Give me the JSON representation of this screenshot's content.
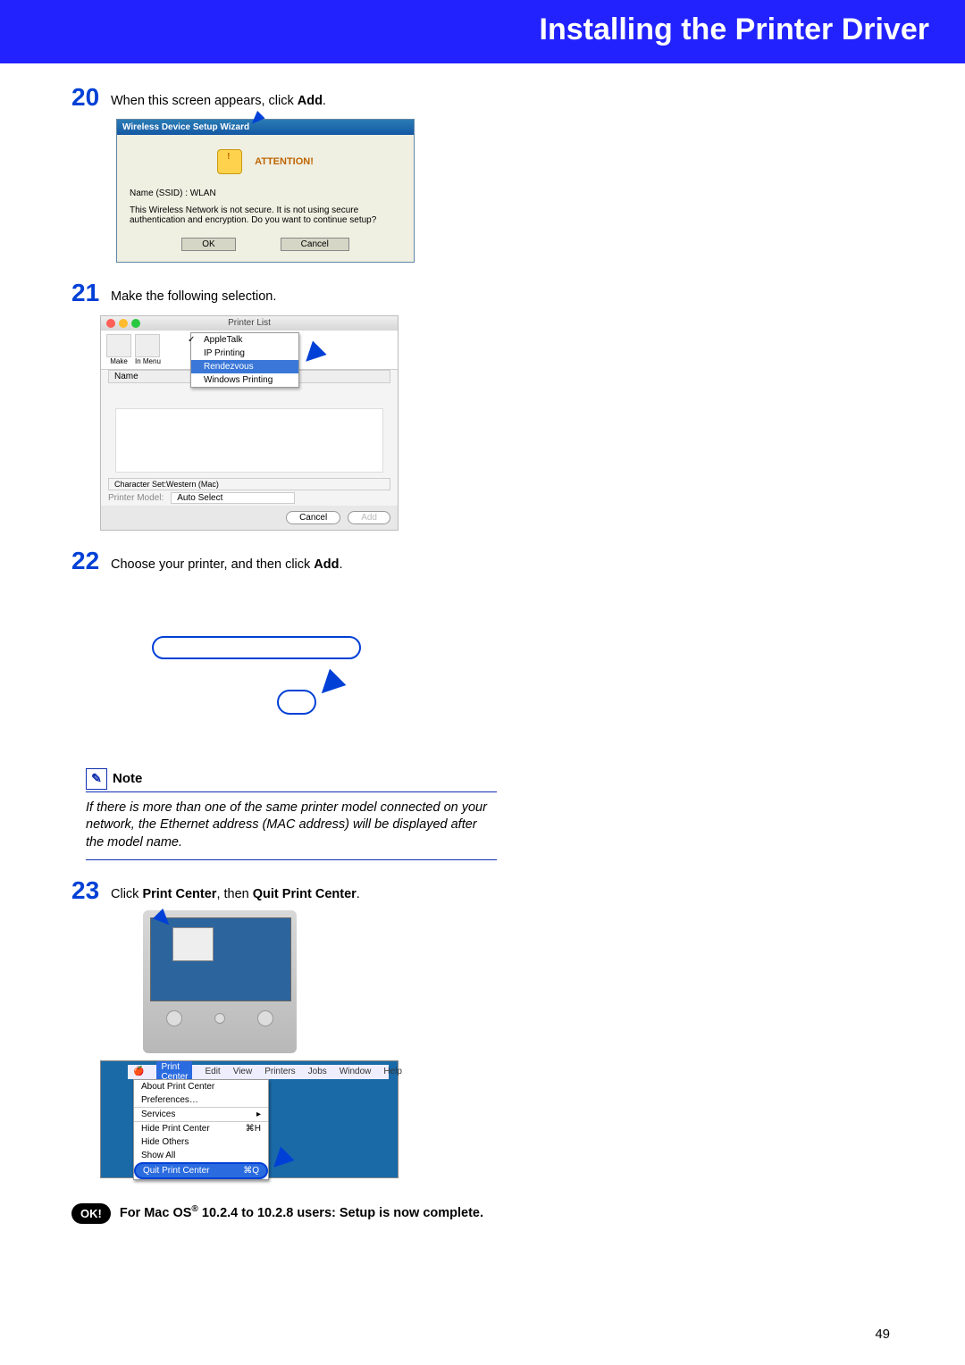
{
  "header": {
    "title": "Installing the Printer Driver"
  },
  "page_number": "49",
  "steps": {
    "s20": {
      "num": "20",
      "text_a": "When this screen appears, click ",
      "bold": "Add",
      "text_b": "."
    },
    "s21": {
      "num": "21",
      "text": "Make the following selection."
    },
    "s22": {
      "num": "22",
      "text_a": "Choose your printer, and then click ",
      "bold": "Add",
      "text_b": "."
    },
    "s23": {
      "num": "23",
      "text_a": "Click ",
      "bold1": "Print Center",
      "text_b": ", then ",
      "bold2": "Quit Print Center",
      "text_c": "."
    }
  },
  "wizard": {
    "title": "Wireless Device Setup Wizard",
    "attention": "ATTENTION!",
    "ssid_label": "Name (SSID) :",
    "ssid_value": "WLAN",
    "warn": "This Wireless Network is not secure. It is not using secure authentication and encryption. Do you want to continue setup?",
    "ok": "OK",
    "cancel": "Cancel"
  },
  "printer_list": {
    "title": "Printer List",
    "make": "Make",
    "in_menu": "In Menu",
    "options": {
      "appletalk": "AppleTalk",
      "ip": "IP Printing",
      "rendezvous": "Rendezvous",
      "win": "Windows Printing"
    },
    "name_col": "Name",
    "charset": "Character Set:Western (Mac)",
    "model_lbl": "Printer Model:",
    "model_val": "Auto Select",
    "cancel": "Cancel",
    "add": "Add"
  },
  "note": {
    "label": "Note",
    "text": "If there is more than one of the same printer model connected on your network, the Ethernet address (MAC address) will be displayed after the model name."
  },
  "menu": {
    "items": {
      "pc": "Print Center",
      "edit": "Edit",
      "view": "View",
      "printers": "Printers",
      "jobs": "Jobs",
      "window": "Window",
      "help": "Help"
    },
    "drop": {
      "about": "About Print Center",
      "prefs": "Preferences…",
      "services": "Services",
      "hide": "Hide Print Center",
      "hide_sc": "⌘H",
      "hideo": "Hide Others",
      "showall": "Show All",
      "quit": "Quit Print Center",
      "quit_sc": "⌘Q"
    }
  },
  "ok": {
    "badge": "OK!",
    "text_a": "For Mac OS",
    "text_b": " 10.2.4 to 10.2.8 users: Setup is now complete."
  }
}
